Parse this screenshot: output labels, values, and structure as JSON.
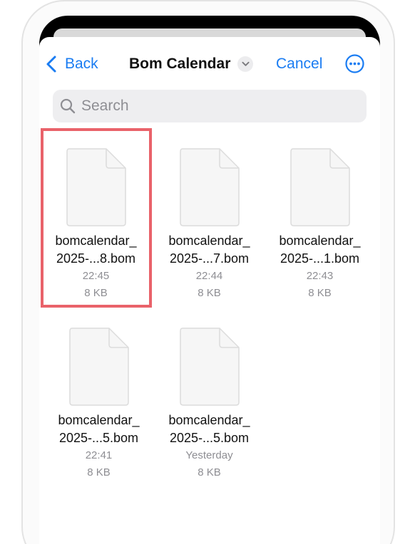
{
  "nav": {
    "back_label": "Back",
    "title": "Bom Calendar",
    "cancel_label": "Cancel"
  },
  "search": {
    "placeholder": "Search"
  },
  "files": [
    {
      "name_line1": "bomcalendar_",
      "name_line2": "2025-...8.bom",
      "time": "22:45",
      "size": "8 KB",
      "selected": true
    },
    {
      "name_line1": "bomcalendar_",
      "name_line2": "2025-...7.bom",
      "time": "22:44",
      "size": "8 KB",
      "selected": false
    },
    {
      "name_line1": "bomcalendar_",
      "name_line2": "2025-...1.bom",
      "time": "22:43",
      "size": "8 KB",
      "selected": false
    },
    {
      "name_line1": "bomcalendar_",
      "name_line2": "2025-...5.bom",
      "time": "22:41",
      "size": "8 KB",
      "selected": false
    },
    {
      "name_line1": "bomcalendar_",
      "name_line2": "2025-...5.bom",
      "time": "Yesterday",
      "size": "8 KB",
      "selected": false
    }
  ],
  "colors": {
    "accent": "#1a7cf2",
    "highlight": "#e9626a",
    "secondary_text": "#8e8e93"
  }
}
